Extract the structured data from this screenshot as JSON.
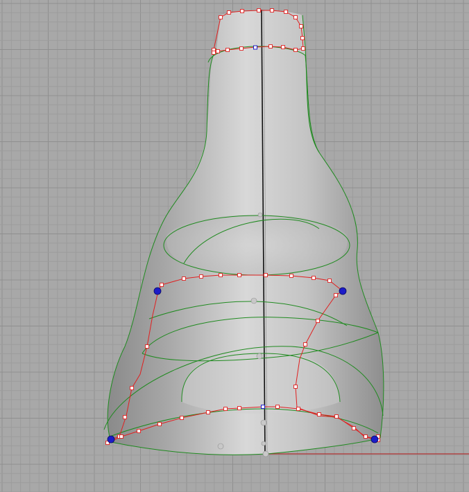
{
  "viewport": {
    "kind": "3D modeling perspective viewport",
    "colors": {
      "background": "#a8a8a8",
      "grid_minor": "#9c9c9c",
      "grid_major": "#8f8f8f",
      "surface_dark": "#8c8c8c",
      "surface_light": "#e0e0e0",
      "isocurve": "#1f8a1f",
      "control_polygon": "#e02020",
      "control_point_fill": "#ffffff",
      "selected_point": "#1c1cc8",
      "axis_x": "#b03030",
      "axis_z": "#101010"
    },
    "icons": [
      "control-point-icon",
      "selected-point-icon",
      "gumball-handle-icon"
    ]
  }
}
